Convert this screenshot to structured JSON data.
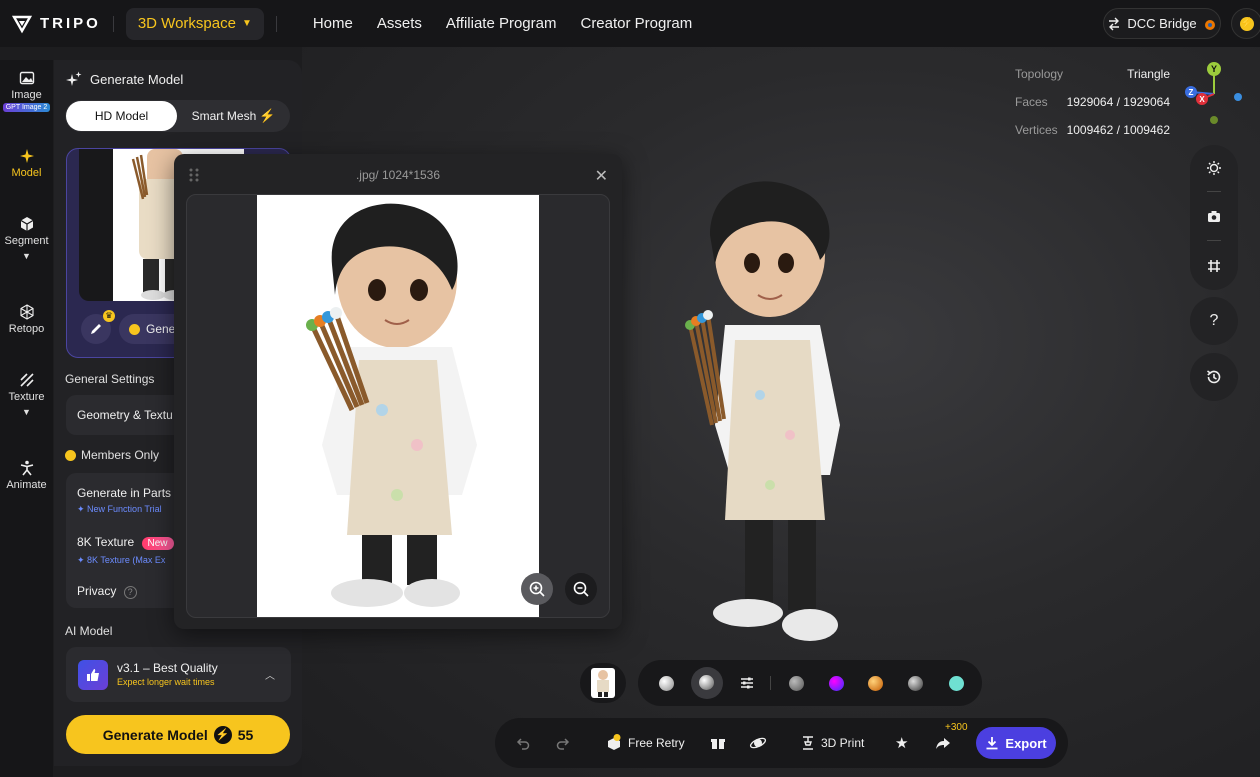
{
  "topbar": {
    "logo_text": "TRIPO",
    "workspace": "3D Workspace",
    "nav": [
      "Home",
      "Assets",
      "Affiliate Program",
      "Creator Program"
    ],
    "dcc_bridge": "DCC Bridge"
  },
  "rail": {
    "items": [
      {
        "label": "Image",
        "badge": "GPT Image 2"
      },
      {
        "label": "Model"
      },
      {
        "label": "Segment"
      },
      {
        "label": "Retopo"
      },
      {
        "label": "Texture"
      },
      {
        "label": "Animate"
      }
    ]
  },
  "panel": {
    "title": "Generate Model",
    "tabs": {
      "hd": "HD Model",
      "smart": "Smart Mesh"
    },
    "gene_button": "Gene",
    "general_settings": "General Settings",
    "geometry_texture": "Geometry & Textu",
    "members_only": "Members Only",
    "generate_in_parts": "Generate in Parts",
    "generate_in_parts_sub": "New Function Trial",
    "texture_8k": "8K Texture",
    "texture_8k_badge": "New",
    "texture_8k_sub": "8K Texture (Max Ex",
    "privacy": "Privacy",
    "ai_model_label": "AI Model",
    "ai_model_name": "v3.1 – Best Quality",
    "ai_model_sub": "Expect longer wait times",
    "generate_button": "Generate Model",
    "generate_cost": "55"
  },
  "viewport": {
    "stats": [
      {
        "label": "Topology",
        "value": "Triangle"
      },
      {
        "label": "Faces",
        "value": "1929064 / 1929064"
      },
      {
        "label": "Vertices",
        "value": "1009462 / 1009462"
      }
    ],
    "help": "?"
  },
  "modal": {
    "title": ".jpg/ 1024*1536"
  },
  "toolbar": {
    "free_retry": "Free Retry",
    "print_3d": "3D Print",
    "bonus": "+300",
    "export": "Export"
  },
  "colors": {
    "accent": "#f7c51e",
    "export": "#4b3fe0",
    "panel": "#222225"
  }
}
